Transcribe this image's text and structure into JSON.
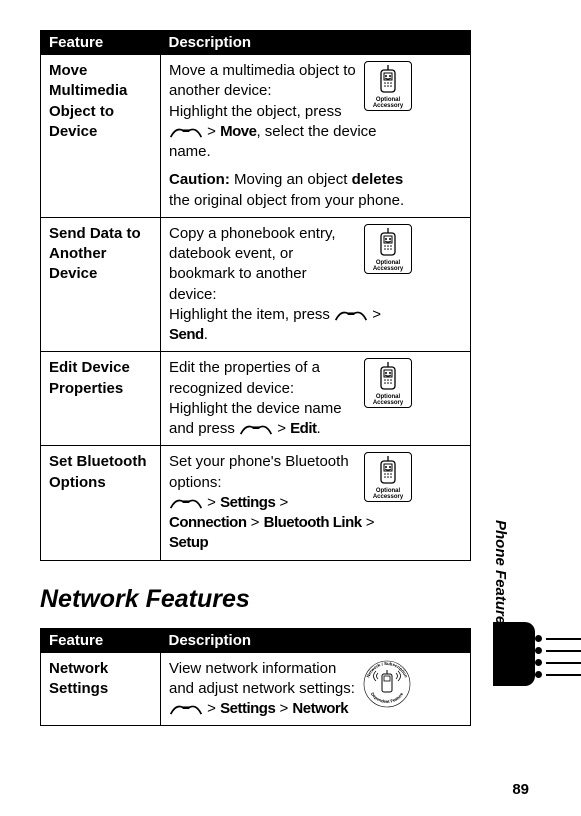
{
  "tables": {
    "phone_features": {
      "headers": {
        "feature": "Feature",
        "description": "Description"
      },
      "rows": {
        "move": {
          "feature": "Move Multimedia Object to Device",
          "d1": "Move a multimedia object to another device:",
          "d2a": "Highlight the object, press ",
          "d2_menu": "Move",
          "d2b": ", select the device name.",
          "caution_label": "Caution:",
          "caution_a": " Moving an object ",
          "caution_bold": "deletes",
          "caution_b": " the original object from your phone.",
          "badge": "Optional Accessory"
        },
        "send": {
          "feature": "Send Data to Another Device",
          "d1": "Copy a phonebook entry, datebook event, or bookmark to another device:",
          "d2a": "Highlight the item, press ",
          "d2_menu": "Send",
          "d2b": ".",
          "badge": "Optional Accessory"
        },
        "edit": {
          "feature": "Edit Device Properties",
          "d1": "Edit the properties of a recognized device:",
          "d2a": "Highlight the device name and press ",
          "d2_menu": "Edit",
          "d2b": ".",
          "badge": "Optional Accessory"
        },
        "bt": {
          "feature": "Set Bluetooth Options",
          "d1": "Set your phone's Bluetooth options:",
          "m1": "Settings",
          "m2": "Connection",
          "m3": "Bluetooth Link",
          "m4": "Setup",
          "badge": "Optional Accessory"
        }
      }
    },
    "network_features": {
      "title": "Network Features",
      "headers": {
        "feature": "Feature",
        "description": "Description"
      },
      "rows": {
        "net": {
          "feature": "Network Settings",
          "d1": "View network information and adjust network settings:",
          "m1": "Settings",
          "m2": "Network",
          "badge_top": "Network / Subscription",
          "badge_bottom": "Dependent Feature"
        }
      }
    }
  },
  "side_tab": "Phone Features",
  "gt": ">",
  "page_number": "89"
}
